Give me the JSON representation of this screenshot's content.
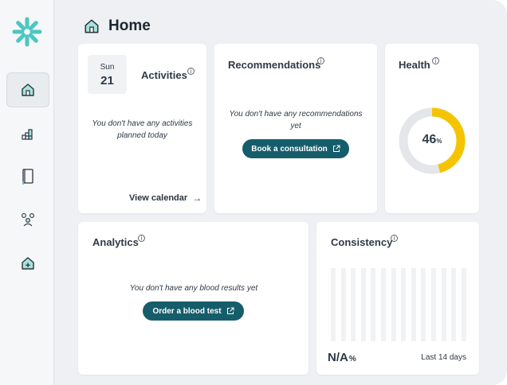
{
  "header": {
    "title": "Home",
    "icon": "home-icon"
  },
  "sidebar": {
    "items": [
      {
        "name": "home",
        "icon": "home-icon",
        "active": true
      },
      {
        "name": "activities",
        "icon": "bars-grid-icon",
        "active": false
      },
      {
        "name": "journal",
        "icon": "notebook-icon",
        "active": false
      },
      {
        "name": "team",
        "icon": "people-icon",
        "active": false
      },
      {
        "name": "clinic",
        "icon": "medical-house-icon",
        "active": false
      }
    ]
  },
  "activities": {
    "dow": "Sun",
    "day": "21",
    "title": "Activities",
    "empty": "You don't have any activities planned today",
    "link": "View calendar"
  },
  "recommendations": {
    "title": "Recommendations",
    "empty": "You don't have any recommendations yet",
    "button": "Book a consultation"
  },
  "health": {
    "title": "Health",
    "value": "46",
    "unit": "%",
    "percent": 46
  },
  "analytics": {
    "title": "Analytics",
    "empty": "You don't have any blood results yet",
    "button": "Order a blood test"
  },
  "consistency": {
    "title": "Consistency",
    "value": "N/A",
    "unit": "%",
    "period": "Last 14 days"
  },
  "colors": {
    "accent": "#165d6b",
    "health": "#f5c400",
    "track": "#e4e6e9",
    "logo": "#4cc7c0"
  }
}
